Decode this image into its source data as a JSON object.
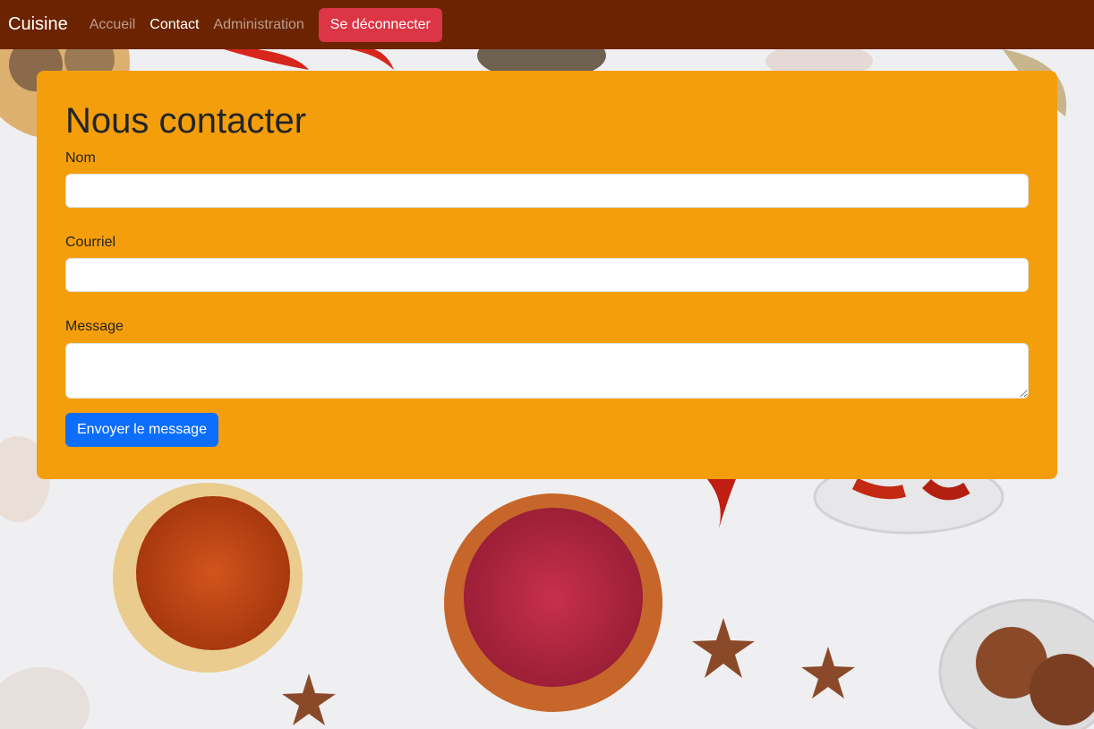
{
  "navbar": {
    "brand": "Cuisine",
    "links": [
      {
        "label": "Accueil",
        "active": false
      },
      {
        "label": "Contact",
        "active": true
      },
      {
        "label": "Administration",
        "active": false
      }
    ],
    "logout_label": "Se déconnecter"
  },
  "contact": {
    "title": "Nous contacter",
    "fields": {
      "name": {
        "label": "Nom",
        "value": "",
        "placeholder": ""
      },
      "email": {
        "label": "Courriel",
        "value": "",
        "placeholder": ""
      },
      "message": {
        "label": "Message",
        "value": "",
        "placeholder": ""
      }
    },
    "submit_label": "Envoyer le message"
  },
  "colors": {
    "navbar": "#6b2300",
    "card": "#f59e0b",
    "logout_button": "#dc3545",
    "submit_button": "#0d6efd"
  }
}
